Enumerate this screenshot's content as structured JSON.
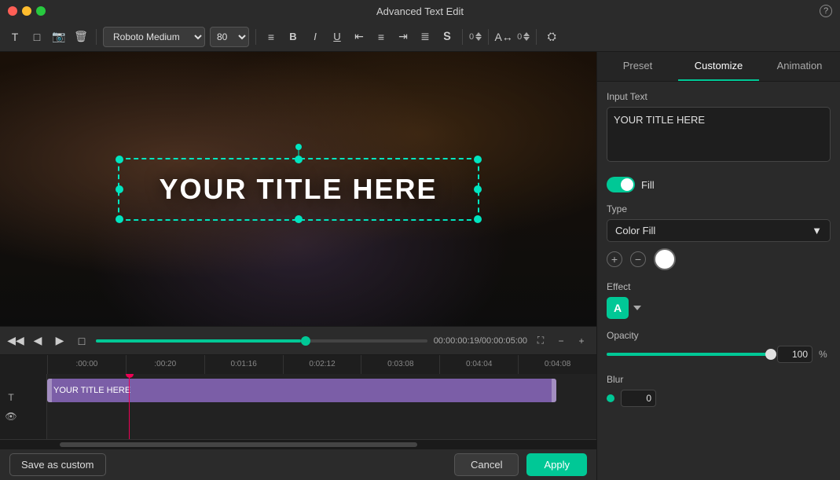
{
  "window": {
    "title": "Advanced Text Edit",
    "help_label": "?"
  },
  "toolbar": {
    "font_name": "Roboto Medium",
    "font_size": "80",
    "bold_label": "B",
    "italic_label": "I",
    "underline_label": "U",
    "strikethrough_label": "S",
    "rotation_value": "0",
    "tracking_value": "0"
  },
  "video": {
    "title_text": "YOUR TITLE HERE",
    "time_current": "00:00:00:19",
    "time_total": "00:00:05:00"
  },
  "timeline": {
    "markers": [
      ":00:00",
      ":00:20",
      "0:01:16",
      "0:02:12",
      "0:03:08",
      "0:04:04",
      "0:04:08"
    ],
    "track_label": "YOUR TITLE HERE"
  },
  "bottom_bar": {
    "save_custom_label": "Save as custom",
    "cancel_label": "Cancel",
    "apply_label": "Apply"
  },
  "right_panel": {
    "tab_preset": "Preset",
    "tab_customize": "Customize",
    "tab_animation": "Animation",
    "active_tab": "Customize",
    "input_text_label": "Input Text",
    "input_text_value": "YOUR TITLE HERE",
    "fill_label": "Fill",
    "type_label": "Type",
    "type_value": "Color Fill",
    "effect_label": "Effect",
    "effect_value": "A",
    "opacity_label": "Opacity",
    "opacity_value": "100",
    "opacity_unit": "%",
    "blur_label": "Blur",
    "blur_value": "0"
  }
}
